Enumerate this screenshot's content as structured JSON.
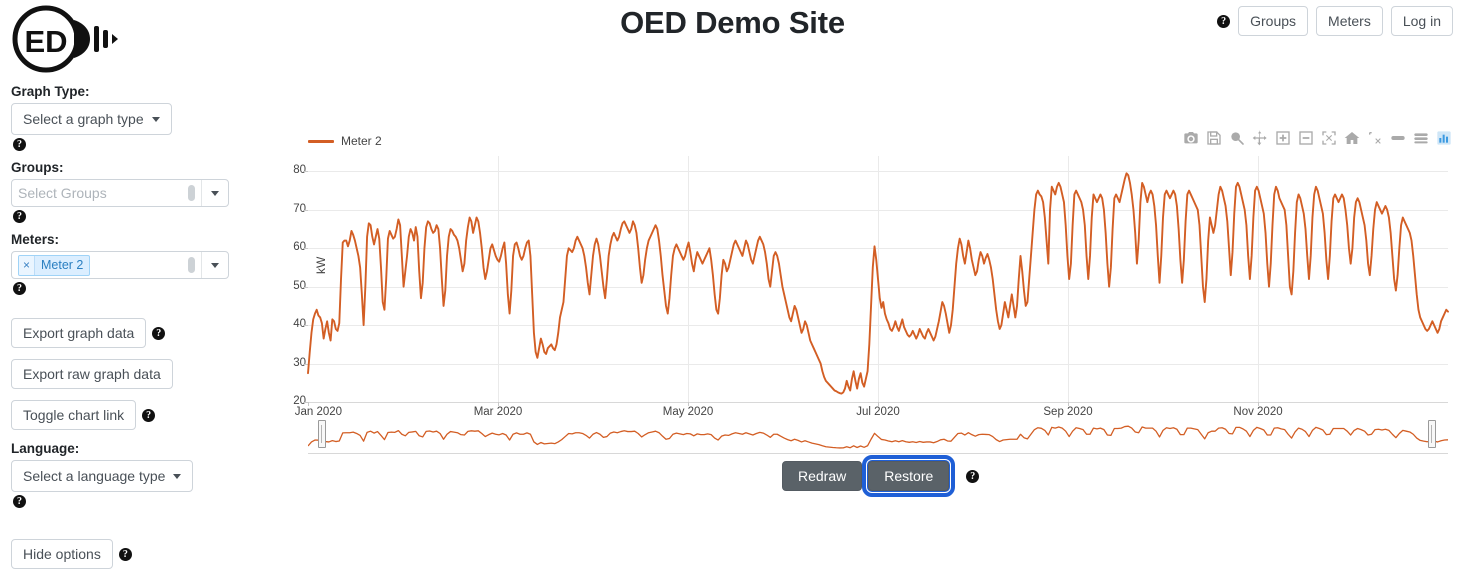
{
  "header": {
    "title": "OED Demo Site",
    "help_icon": "question-mark-icon",
    "buttons": [
      {
        "id": "groups",
        "label": "Groups"
      },
      {
        "id": "meters",
        "label": "Meters"
      },
      {
        "id": "login",
        "label": "Log in"
      }
    ]
  },
  "logo": {
    "text": "ED",
    "alt": "oed-logo"
  },
  "panel": {
    "graph_type": {
      "label": "Graph Type:",
      "selected": "Select a graph type",
      "help": "?"
    },
    "groups": {
      "label": "Groups:",
      "placeholder": "Select Groups",
      "help": "?"
    },
    "meters": {
      "label": "Meters:",
      "placeholder": "",
      "tags": [
        {
          "label": "Meter 2",
          "remove": "×"
        }
      ],
      "help": "?"
    },
    "actions": [
      {
        "id": "export-graph-data",
        "label": "Export graph data",
        "help": true
      },
      {
        "id": "export-raw-graph-data",
        "label": "Export raw graph data",
        "help": false
      },
      {
        "id": "toggle-chart-link",
        "label": "Toggle chart link",
        "help": true
      }
    ],
    "language": {
      "label": "Language:",
      "selected": "Select a language type",
      "help": "?"
    },
    "hide_options": {
      "label": "Hide options",
      "help": "?"
    }
  },
  "chart_toolbar": {
    "icons": [
      "camera-icon",
      "save-disk-icon",
      "zoom-icon",
      "pan-icon",
      "zoom-in-icon",
      "zoom-out-icon",
      "autoscale-icon",
      "home-reset-icon",
      "spike-lines-icon",
      "hover-closest-icon",
      "hover-compare-icon",
      "plotly-logo-icon"
    ],
    "active_index": 11,
    "active_color": "#3b9ae1"
  },
  "bottom_controls": {
    "redraw_label": "Redraw",
    "restore_label": "Restore",
    "focused": "restore",
    "help": "?",
    "focus_color": "#1f5fd6"
  },
  "chart_data": {
    "type": "line",
    "title": "",
    "xlabel": "",
    "ylabel": "kW",
    "line_color": "#D35E24",
    "grid": true,
    "legend_position": "top-left",
    "xlim": [
      "Jan 2020",
      "Dec 2020"
    ],
    "ylim": [
      20,
      84
    ],
    "yticks": [
      20,
      30,
      40,
      50,
      60,
      70,
      80
    ],
    "xticks": [
      "Jan 2020",
      "Mar 2020",
      "May 2020",
      "Jul 2020",
      "Sep 2020",
      "Nov 2020"
    ],
    "series": [
      {
        "name": "Meter 2",
        "color": "#D35E24",
        "values": [
          27.5,
          33,
          38,
          41.5,
          43,
          44,
          42.5,
          42,
          40.5,
          36.5,
          39,
          41,
          38,
          36,
          41.5,
          41,
          39,
          38.5,
          40.5,
          52,
          61.5,
          62,
          62,
          60.5,
          62,
          64.5,
          63.5,
          62,
          60,
          58,
          55,
          48,
          40,
          50,
          63,
          66.5,
          66,
          63,
          61,
          63,
          65,
          62.5,
          55,
          46,
          44,
          52,
          62.5,
          64.5,
          63.5,
          62.5,
          63,
          65,
          67.5,
          66,
          58,
          50,
          54,
          58,
          63,
          65,
          64,
          62,
          65.5,
          63,
          54,
          47,
          51,
          60,
          65.5,
          67,
          66.5,
          65,
          64,
          64.5,
          66,
          65,
          60,
          52,
          45,
          49,
          58,
          63,
          65,
          64.5,
          63.5,
          63,
          62,
          60,
          57,
          54,
          56,
          62,
          65.5,
          68,
          67,
          64,
          66,
          68,
          67,
          64,
          60,
          55,
          52,
          54,
          57,
          60,
          61,
          59.5,
          58,
          57,
          56.5,
          58,
          60,
          61.5,
          56,
          48,
          43,
          49,
          58,
          61,
          61.5,
          60,
          58,
          57,
          58,
          60,
          61.5,
          62,
          58,
          48,
          38,
          33,
          31.5,
          34,
          36.5,
          35,
          33,
          32.5,
          34,
          34.5,
          35,
          34,
          33.5,
          35,
          38,
          42,
          44,
          46,
          52,
          58,
          60,
          59.5,
          59,
          60,
          62,
          63,
          62,
          61,
          60,
          58,
          55,
          51,
          48,
          53,
          58,
          61,
          62.5,
          61,
          58,
          54,
          50,
          47,
          52,
          58,
          61,
          63,
          64,
          63,
          62,
          63,
          65,
          66.5,
          67,
          66,
          65,
          64,
          65,
          67,
          66,
          64,
          60,
          55,
          51,
          53,
          57,
          60,
          62,
          63,
          64,
          65,
          66,
          65,
          62,
          58,
          53,
          49,
          45,
          43,
          47,
          53,
          58,
          60,
          61,
          60,
          59,
          58,
          57,
          58,
          60,
          61.5,
          59,
          56,
          54,
          57,
          59,
          58,
          57,
          56,
          57,
          58,
          59,
          60,
          57,
          53,
          48,
          44,
          43,
          47,
          53,
          57,
          56,
          54,
          55,
          57,
          59,
          61,
          62,
          61,
          60,
          59,
          58,
          60,
          62,
          61,
          59,
          57,
          56,
          58,
          60,
          62,
          63,
          62,
          61,
          59,
          56,
          52,
          50,
          54,
          58,
          59,
          58,
          56,
          53,
          50,
          48,
          46,
          44,
          42,
          41,
          43,
          45,
          44,
          42,
          40,
          38,
          39,
          41,
          40,
          38,
          36,
          35,
          34,
          33,
          32,
          31,
          30,
          28,
          26.5,
          25.5,
          25,
          24.5,
          24,
          23.5,
          23,
          22.8,
          22.5,
          22.3,
          22.2,
          22.5,
          23.5,
          25.5,
          24,
          23,
          26,
          28,
          25.5,
          23.5,
          26,
          27.5,
          25,
          24,
          26,
          28,
          35,
          45,
          55,
          60.5,
          57,
          52,
          47,
          44.5,
          46,
          43,
          41.5,
          40.5,
          39,
          38.5,
          39.5,
          41,
          39.5,
          38.5,
          40,
          41.5,
          39.5,
          38.5,
          37.5,
          37,
          37.5,
          38.5,
          37.5,
          36.5,
          37.5,
          39,
          38,
          37,
          36.5,
          38,
          39,
          38,
          37,
          36,
          37,
          39,
          41,
          43.5,
          46,
          45,
          43,
          40.5,
          38,
          40,
          44,
          50,
          56,
          60,
          62.5,
          61,
          58,
          56,
          59,
          62,
          60,
          57,
          55,
          53,
          54,
          57,
          59,
          58,
          56,
          57.5,
          58.5,
          57,
          55,
          52,
          48,
          44,
          41,
          39,
          40,
          43,
          46,
          44,
          42,
          45,
          48,
          45,
          42,
          45,
          52,
          58,
          54,
          49,
          45,
          46,
          52,
          58,
          64,
          70,
          74,
          75,
          74,
          73.5,
          72,
          68,
          62,
          56,
          70,
          76,
          75,
          74,
          76,
          77,
          76,
          74,
          72,
          66,
          58,
          52,
          56,
          66,
          74,
          75,
          74,
          73,
          72,
          70,
          66,
          58,
          52,
          58,
          68,
          74,
          73,
          72,
          73,
          74,
          73,
          70,
          64,
          56,
          50,
          55,
          65,
          73,
          74,
          73,
          72,
          74,
          76,
          78,
          79.5,
          79,
          77,
          74,
          70,
          64,
          56,
          62,
          72,
          77,
          76,
          74,
          72,
          74,
          75,
          74,
          71,
          66,
          58,
          51,
          58,
          68,
          74,
          75,
          74,
          73,
          74,
          75,
          74,
          71,
          65,
          57,
          51,
          57,
          67,
          74,
          75,
          74,
          73,
          72,
          71,
          70,
          66,
          58,
          50,
          46,
          52,
          62,
          68,
          66,
          64,
          66,
          70,
          74,
          76,
          75,
          73,
          71,
          67,
          60,
          53,
          59,
          69,
          76,
          77,
          76,
          74,
          72,
          70,
          66,
          58,
          52,
          58,
          68,
          75,
          76,
          75,
          73,
          71,
          69,
          64,
          56,
          50,
          56,
          66,
          74,
          76,
          75,
          73,
          72,
          71,
          70,
          66,
          58,
          50,
          48,
          54,
          64,
          72,
          74,
          73,
          71,
          69,
          65,
          58,
          52,
          58,
          68,
          74,
          76,
          75,
          73,
          71,
          69,
          64,
          57,
          52,
          58,
          67,
          73,
          74,
          73,
          72,
          73,
          74,
          73,
          70,
          66,
          60,
          56,
          60,
          68,
          72,
          73,
          72,
          70,
          68,
          66,
          62,
          56,
          53,
          58,
          65,
          70,
          72,
          71,
          70,
          69,
          70,
          71,
          70,
          68,
          64,
          58,
          52,
          49,
          53,
          60,
          66,
          68,
          67,
          66,
          65,
          64,
          62,
          58,
          53,
          48,
          44,
          42,
          41,
          40,
          39,
          38.5,
          39,
          40,
          41,
          40,
          39,
          38,
          39,
          41,
          42,
          43,
          44,
          43.5
        ]
      }
    ],
    "rangeslider": {
      "visible": true,
      "full_range": true
    }
  }
}
